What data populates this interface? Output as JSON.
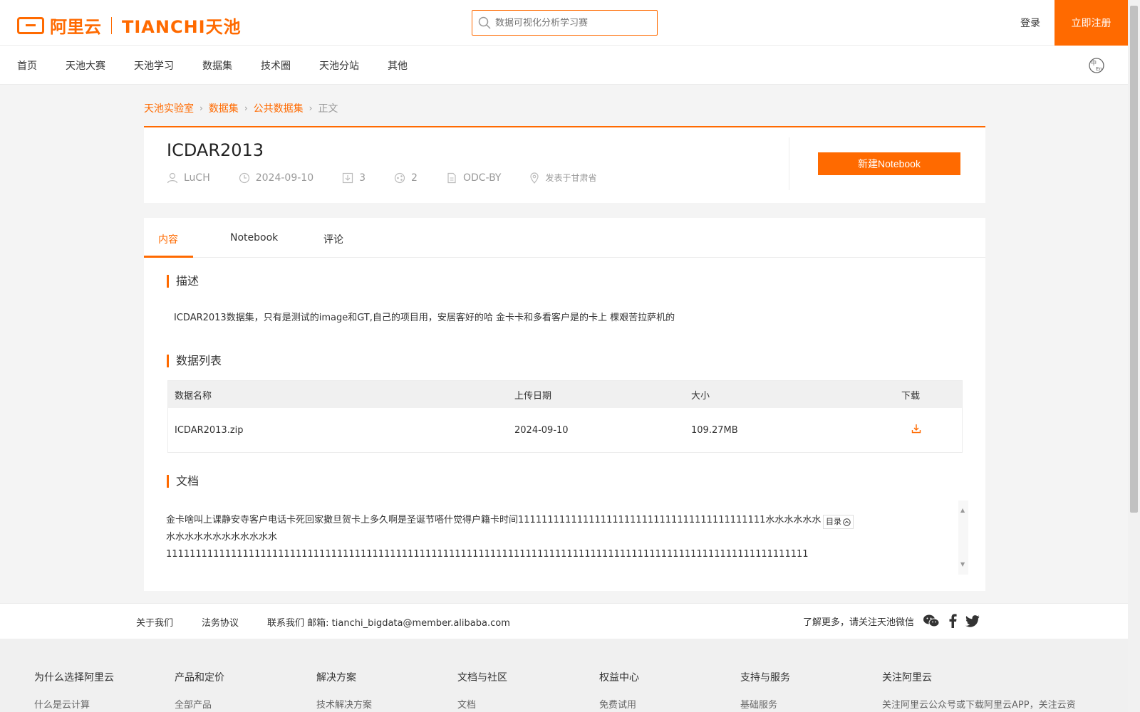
{
  "header": {
    "logo_text": "阿里云",
    "logo_tianchi": "TIANCHI天池",
    "search_placeholder": "数据可视化分析学习赛",
    "login": "登录",
    "register": "立即注册"
  },
  "nav": {
    "items": [
      "首页",
      "天池大赛",
      "天池学习",
      "数据集",
      "技术圈",
      "天池分站",
      "其他"
    ],
    "lang_icon": "language-cn-en-icon"
  },
  "breadcrumb": {
    "items": [
      "天池实验室",
      "数据集",
      "公共数据集",
      "正文"
    ]
  },
  "dataset": {
    "title": "ICDAR2013",
    "author": "LuCH",
    "date": "2024-09-10",
    "downloads": "3",
    "shares": "2",
    "license": "ODC-BY",
    "location": "发表于甘肃省",
    "new_notebook": "新建Notebook"
  },
  "tabs": [
    "内容",
    "Notebook",
    "评论"
  ],
  "sections": {
    "description_title": "描述",
    "description_text": "ICDAR2013数据集，只有是测试的image和GT,自己的项目用，安居客好的哈 金卡卡和多看客户是的卡上 棵艰苦拉萨机的",
    "data_list_title": "数据列表",
    "doc_title": "文档"
  },
  "data_table": {
    "headers": [
      "数据名称",
      "上传日期",
      "大小",
      "下载"
    ],
    "rows": [
      {
        "name": "ICDAR2013.zip",
        "date": "2024-09-10",
        "size": "109.27MB"
      }
    ]
  },
  "doc": {
    "line1": "金卡啥叫上课静安寺客户电话卡死回家撒旦贺卡上多久啊是圣诞节嗒什觉得户籍卡时间111111111111111111111111111111111111111111水水水水水水水水水水水水水水水水水水",
    "line2": "1111111111111111111111111111111111111111111111111111111111111111111111111111111111111111111111111111111111111",
    "toc": "目录"
  },
  "footer": {
    "links": [
      "关于我们",
      "法务协议",
      "联系我们 邮箱: tianchi_bigdata@member.alibaba.com"
    ],
    "follow_text": "了解更多，请关注天池微信",
    "columns": [
      {
        "heading": "为什么选择阿里云",
        "link": "什么是云计算"
      },
      {
        "heading": "产品和定价",
        "link": "全部产品"
      },
      {
        "heading": "解决方案",
        "link": "技术解决方案"
      },
      {
        "heading": "文档与社区",
        "link": "文档"
      },
      {
        "heading": "权益中心",
        "link": "免费试用"
      },
      {
        "heading": "支持与服务",
        "link": "基础服务"
      },
      {
        "heading": "关注阿里云",
        "link": "关注阿里云公众号或下载阿里云APP，关注云资"
      }
    ]
  },
  "colors": {
    "accent": "#ff6a00"
  }
}
